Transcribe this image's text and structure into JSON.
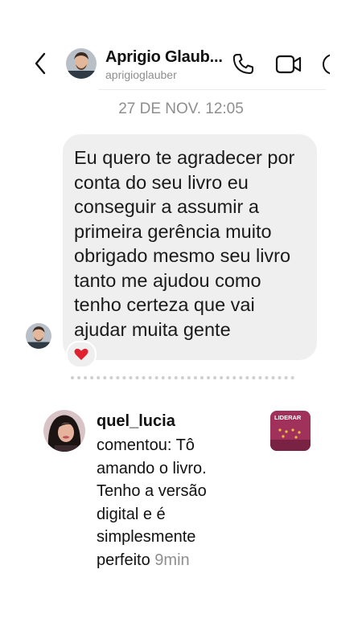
{
  "header": {
    "contact_name": "Aprigio Glaub...",
    "contact_username": "aprigioglauber"
  },
  "conversation": {
    "timestamp": "27 DE NOV. 12:05",
    "message": {
      "lines": [
        "Eu quero te agradecer por",
        "conta do seu livro eu",
        "conseguir a assumir a",
        "primeira gerência muito",
        "obrigado mesmo seu livro",
        "tanto me ajudou como",
        "tenho certeza que vai",
        "ajudar muita gente"
      ],
      "reaction": "heart-icon"
    }
  },
  "comment": {
    "username": "quel_lucia",
    "lines": [
      "comentou: Tô",
      "amando o livro.",
      "Tenho a versão",
      "digital e é",
      "simplesmente",
      "perfeito"
    ],
    "time": "9min",
    "thumbnail_text": "LIDERAR"
  },
  "colors": {
    "bubble_bg": "#efefef",
    "muted_text": "#8e8e8e",
    "heart": "#e0212e",
    "thumbnail_bg": "#a0315a"
  }
}
